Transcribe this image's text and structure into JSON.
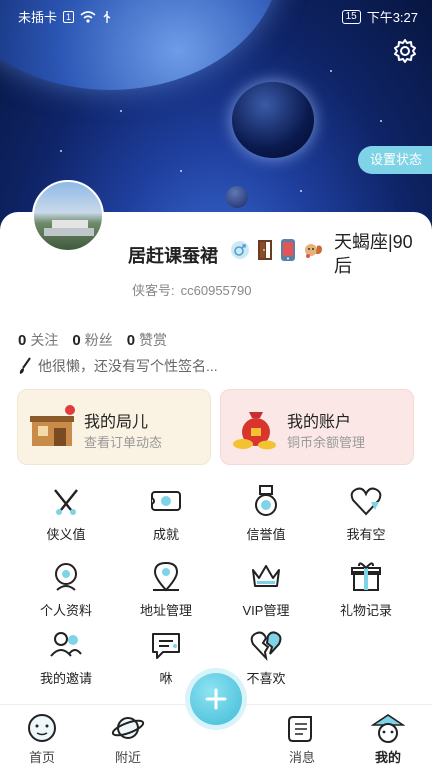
{
  "status_bar": {
    "carrier": "未插卡",
    "sim": "1",
    "battery": "15",
    "time": "下午3:27"
  },
  "header": {
    "status_button": "设置状态",
    "gear_icon": "gear-icon"
  },
  "profile": {
    "nickname": "居赶课蚕裙",
    "constellation": "天蝎座|90后",
    "uid_label": "侠客号:",
    "uid_value": "cc60955790",
    "badges": [
      "male-icon",
      "door-icon",
      "phone-icon",
      "pet-icon"
    ]
  },
  "stats": [
    {
      "count": "0",
      "label": "关注"
    },
    {
      "count": "0",
      "label": "粉丝"
    },
    {
      "count": "0",
      "label": "赞赏"
    }
  ],
  "signature": "他很懒，还没有写个性签名...",
  "cards": {
    "orders": {
      "title": "我的局儿",
      "sub": "查看订单动态"
    },
    "account": {
      "title": "我的账户",
      "sub": "铜币余额管理"
    }
  },
  "menu": [
    {
      "label": "侠义值",
      "icon": "swords-icon"
    },
    {
      "label": "成就",
      "icon": "ticket-icon"
    },
    {
      "label": "信誉值",
      "icon": "medal-icon"
    },
    {
      "label": "我有空",
      "icon": "heart-icon"
    },
    {
      "label": "个人资料",
      "icon": "profile-icon"
    },
    {
      "label": "地址管理",
      "icon": "location-icon"
    },
    {
      "label": "VIP管理",
      "icon": "crown-icon"
    },
    {
      "label": "礼物记录",
      "icon": "gift-icon"
    },
    {
      "label": "我的邀请",
      "icon": "invite-icon"
    },
    {
      "label": "咻",
      "icon": "chat-icon"
    },
    {
      "label": "不喜欢",
      "icon": "broken-heart-icon"
    }
  ],
  "tabs": [
    {
      "label": "首页",
      "icon": "home-face-icon"
    },
    {
      "label": "附近",
      "icon": "planet-icon"
    },
    {
      "label": "消息",
      "icon": "scroll-icon"
    },
    {
      "label": "我的",
      "icon": "me-hat-icon"
    }
  ],
  "colors": {
    "accent": "#3fbbd7",
    "status_pill": "#7fd3e6",
    "orders_card": "#faf2e3",
    "account_card": "#fbe8e6"
  }
}
